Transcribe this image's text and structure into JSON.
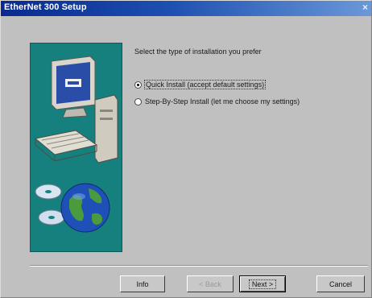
{
  "window": {
    "title": "EtherNet 300 Setup",
    "titlebar_colors": [
      "#0a2a8f",
      "#6a98d8"
    ]
  },
  "art_panel": {
    "background": "#16807e",
    "depicts": [
      "computer-icon",
      "cd-disc-icon",
      "globe-icon"
    ]
  },
  "content": {
    "prompt": "Select the type of installation you prefer",
    "options": [
      {
        "label": "Quick Install (accept default settings)",
        "selected": true
      },
      {
        "label": "Step-By-Step Install (let me choose my settings)",
        "selected": false
      }
    ]
  },
  "buttons": {
    "info": "Info",
    "back": "< Back",
    "next": "Next >",
    "cancel": "Cancel"
  }
}
